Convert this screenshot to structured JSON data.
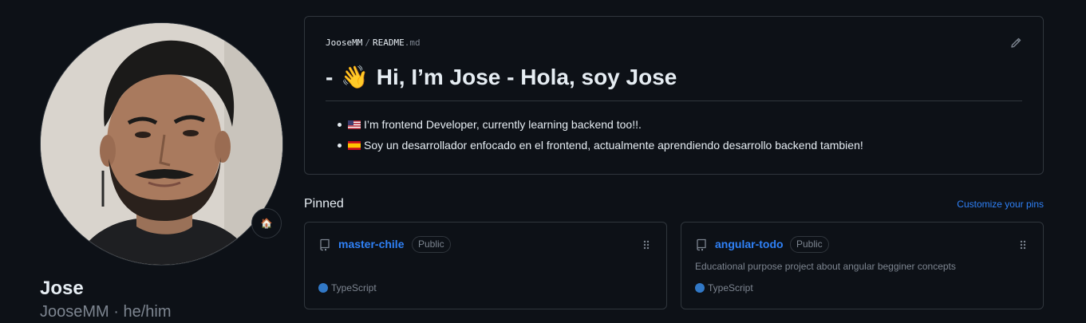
{
  "profile": {
    "name": "Jose",
    "login_line": "JooseMM · he/him",
    "status_emoji": "🏠"
  },
  "readme": {
    "path_user": "JooseMM",
    "path_sep": "/",
    "path_file": "README",
    "path_ext": ".md",
    "heading_prefix": "-",
    "heading_emoji": "👋",
    "heading_text": "Hi, I’m Jose - Hola, soy Jose",
    "items": [
      {
        "flag": "us-flag-icon",
        "text": "I’m frontend Developer, currently learning backend too!!."
      },
      {
        "flag": "es-flag-icon",
        "text": "Soy un desarrollador enfocado en el frontend, actualmente aprendiendo desarrollo backend tambien!"
      }
    ]
  },
  "pinned": {
    "title": "Pinned",
    "customize_label": "Customize your pins",
    "repos": [
      {
        "name": "master-chile",
        "visibility": "Public",
        "description": "",
        "language": "TypeScript",
        "language_color": "#3178c6"
      },
      {
        "name": "angular-todo",
        "visibility": "Public",
        "description": "Educational purpose project about angular begginer concepts",
        "language": "TypeScript",
        "language_color": "#3178c6"
      }
    ]
  },
  "colors": {
    "background": "#0d1117",
    "border": "#30363d",
    "link": "#2f81f7",
    "muted": "#7d8590",
    "text": "#e6edf3"
  }
}
